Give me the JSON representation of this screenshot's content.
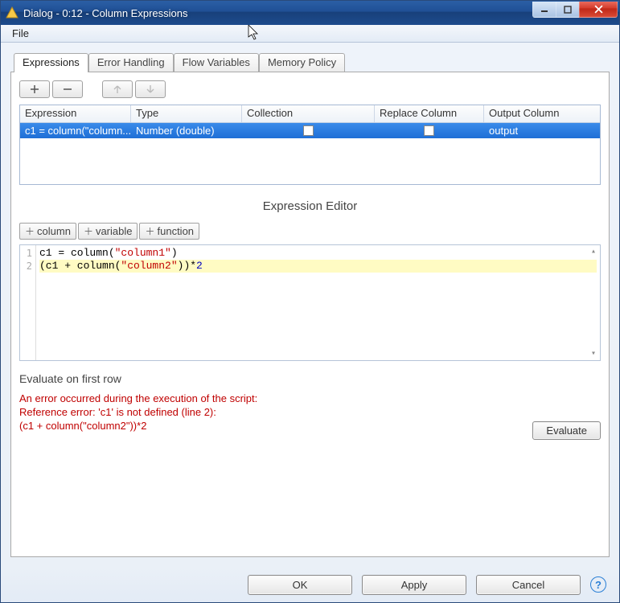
{
  "window": {
    "title": "Dialog - 0:12 - Column Expressions"
  },
  "menu": {
    "file": "File"
  },
  "tabs": {
    "expressions": "Expressions",
    "error_handling": "Error Handling",
    "flow_variables": "Flow Variables",
    "memory_policy": "Memory Policy"
  },
  "grid": {
    "headers": {
      "expression": "Expression",
      "type": "Type",
      "collection": "Collection",
      "replace_column": "Replace Column",
      "output_column": "Output Column"
    },
    "rows": [
      {
        "expression": "c1 = column(\"column...",
        "type": "Number (double)",
        "collection": false,
        "replace_column": false,
        "output_column": "output"
      }
    ]
  },
  "editor": {
    "title": "Expression Editor",
    "insert_buttons": {
      "column": "column",
      "variable": "variable",
      "function": "function"
    },
    "gutter": [
      "1",
      "2"
    ],
    "lines_plain": [
      "c1 = column(\"column1\")",
      "(c1 + column(\"column2\"))*2"
    ]
  },
  "evaluate": {
    "label": "Evaluate on first row",
    "error_lines": [
      "An error occurred during the execution of the script:",
      "Reference error: 'c1' is not defined (line 2):",
      "(c1 + column(\"column2\"))*2"
    ],
    "button": "Evaluate"
  },
  "footer": {
    "ok": "OK",
    "apply": "Apply",
    "cancel": "Cancel"
  }
}
